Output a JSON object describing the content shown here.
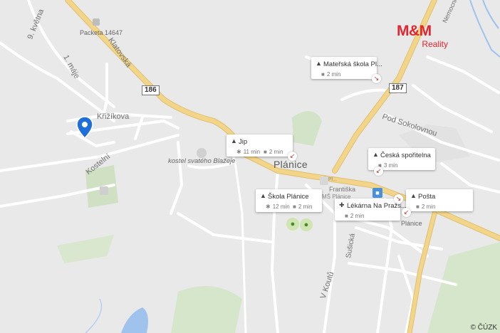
{
  "map": {
    "colors": {
      "background": "#e9e9e9",
      "main_road": "#f3d58a",
      "main_road_edge": "#e0c070",
      "minor_road": "#ffffff",
      "water": "#9fc3ec",
      "park": "#cfe0c3",
      "brand": "#e3262d"
    }
  },
  "roads": {
    "street_9kvetna": "9. května",
    "street_1maje": "1. máje",
    "street_klatovska": "Klatovská",
    "street_krizikova": "Křižíkova",
    "street_kostelni": "Kostelní",
    "street_podsokolovnou": "Pod Sokolovnou",
    "street_sulicka": "Sušická",
    "street_vkoutu": "V Koutů",
    "street_nemocnicni": "Nemocniční",
    "route_186": "186",
    "route_187": "187"
  },
  "places": {
    "packeta": "Packeta 14647",
    "church": "kostel svatého Blažeje",
    "town": "Plánice",
    "frantiska": "Františka",
    "zs": "ZŠ Pl...",
    "ms": "MŠ Plánice",
    "town_small": "Plánice"
  },
  "pois": [
    {
      "name": "Mateřská škola Pl...",
      "icon": "school-icon",
      "walk": "",
      "drive": "2 min"
    },
    {
      "name": "Jip",
      "icon": "cart-icon",
      "walk": "11 min",
      "drive": "2 min"
    },
    {
      "name": "Česká spořitelna",
      "icon": "bank-icon",
      "walk": "",
      "drive": "3 min"
    },
    {
      "name": "Škola Plánice",
      "icon": "school-icon",
      "walk": "12 min",
      "drive": "2 min"
    },
    {
      "name": "Lékárna Na Pražs...",
      "icon": "pharmacy-icon",
      "walk": "",
      "drive": "2 min"
    },
    {
      "name": "Pošta",
      "icon": "post-icon",
      "walk": "",
      "drive": "2 min"
    }
  ],
  "logo": {
    "brand": "M&M",
    "sub": "Reality"
  },
  "copyright": "© ČÚZK"
}
